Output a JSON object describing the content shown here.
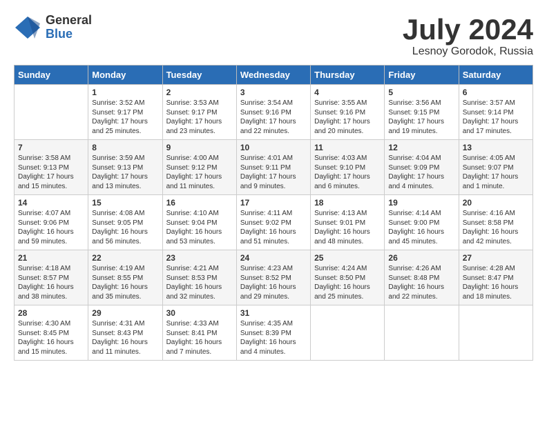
{
  "header": {
    "logo_general": "General",
    "logo_blue": "Blue",
    "month_title": "July 2024",
    "location": "Lesnoy Gorodok, Russia"
  },
  "days_of_week": [
    "Sunday",
    "Monday",
    "Tuesday",
    "Wednesday",
    "Thursday",
    "Friday",
    "Saturday"
  ],
  "weeks": [
    [
      {
        "day": "",
        "sunrise": "",
        "sunset": "",
        "daylight": ""
      },
      {
        "day": "1",
        "sunrise": "Sunrise: 3:52 AM",
        "sunset": "Sunset: 9:17 PM",
        "daylight": "Daylight: 17 hours and 25 minutes."
      },
      {
        "day": "2",
        "sunrise": "Sunrise: 3:53 AM",
        "sunset": "Sunset: 9:17 PM",
        "daylight": "Daylight: 17 hours and 23 minutes."
      },
      {
        "day": "3",
        "sunrise": "Sunrise: 3:54 AM",
        "sunset": "Sunset: 9:16 PM",
        "daylight": "Daylight: 17 hours and 22 minutes."
      },
      {
        "day": "4",
        "sunrise": "Sunrise: 3:55 AM",
        "sunset": "Sunset: 9:16 PM",
        "daylight": "Daylight: 17 hours and 20 minutes."
      },
      {
        "day": "5",
        "sunrise": "Sunrise: 3:56 AM",
        "sunset": "Sunset: 9:15 PM",
        "daylight": "Daylight: 17 hours and 19 minutes."
      },
      {
        "day": "6",
        "sunrise": "Sunrise: 3:57 AM",
        "sunset": "Sunset: 9:14 PM",
        "daylight": "Daylight: 17 hours and 17 minutes."
      }
    ],
    [
      {
        "day": "7",
        "sunrise": "Sunrise: 3:58 AM",
        "sunset": "Sunset: 9:13 PM",
        "daylight": "Daylight: 17 hours and 15 minutes."
      },
      {
        "day": "8",
        "sunrise": "Sunrise: 3:59 AM",
        "sunset": "Sunset: 9:13 PM",
        "daylight": "Daylight: 17 hours and 13 minutes."
      },
      {
        "day": "9",
        "sunrise": "Sunrise: 4:00 AM",
        "sunset": "Sunset: 9:12 PM",
        "daylight": "Daylight: 17 hours and 11 minutes."
      },
      {
        "day": "10",
        "sunrise": "Sunrise: 4:01 AM",
        "sunset": "Sunset: 9:11 PM",
        "daylight": "Daylight: 17 hours and 9 minutes."
      },
      {
        "day": "11",
        "sunrise": "Sunrise: 4:03 AM",
        "sunset": "Sunset: 9:10 PM",
        "daylight": "Daylight: 17 hours and 6 minutes."
      },
      {
        "day": "12",
        "sunrise": "Sunrise: 4:04 AM",
        "sunset": "Sunset: 9:09 PM",
        "daylight": "Daylight: 17 hours and 4 minutes."
      },
      {
        "day": "13",
        "sunrise": "Sunrise: 4:05 AM",
        "sunset": "Sunset: 9:07 PM",
        "daylight": "Daylight: 17 hours and 1 minute."
      }
    ],
    [
      {
        "day": "14",
        "sunrise": "Sunrise: 4:07 AM",
        "sunset": "Sunset: 9:06 PM",
        "daylight": "Daylight: 16 hours and 59 minutes."
      },
      {
        "day": "15",
        "sunrise": "Sunrise: 4:08 AM",
        "sunset": "Sunset: 9:05 PM",
        "daylight": "Daylight: 16 hours and 56 minutes."
      },
      {
        "day": "16",
        "sunrise": "Sunrise: 4:10 AM",
        "sunset": "Sunset: 9:04 PM",
        "daylight": "Daylight: 16 hours and 53 minutes."
      },
      {
        "day": "17",
        "sunrise": "Sunrise: 4:11 AM",
        "sunset": "Sunset: 9:02 PM",
        "daylight": "Daylight: 16 hours and 51 minutes."
      },
      {
        "day": "18",
        "sunrise": "Sunrise: 4:13 AM",
        "sunset": "Sunset: 9:01 PM",
        "daylight": "Daylight: 16 hours and 48 minutes."
      },
      {
        "day": "19",
        "sunrise": "Sunrise: 4:14 AM",
        "sunset": "Sunset: 9:00 PM",
        "daylight": "Daylight: 16 hours and 45 minutes."
      },
      {
        "day": "20",
        "sunrise": "Sunrise: 4:16 AM",
        "sunset": "Sunset: 8:58 PM",
        "daylight": "Daylight: 16 hours and 42 minutes."
      }
    ],
    [
      {
        "day": "21",
        "sunrise": "Sunrise: 4:18 AM",
        "sunset": "Sunset: 8:57 PM",
        "daylight": "Daylight: 16 hours and 38 minutes."
      },
      {
        "day": "22",
        "sunrise": "Sunrise: 4:19 AM",
        "sunset": "Sunset: 8:55 PM",
        "daylight": "Daylight: 16 hours and 35 minutes."
      },
      {
        "day": "23",
        "sunrise": "Sunrise: 4:21 AM",
        "sunset": "Sunset: 8:53 PM",
        "daylight": "Daylight: 16 hours and 32 minutes."
      },
      {
        "day": "24",
        "sunrise": "Sunrise: 4:23 AM",
        "sunset": "Sunset: 8:52 PM",
        "daylight": "Daylight: 16 hours and 29 minutes."
      },
      {
        "day": "25",
        "sunrise": "Sunrise: 4:24 AM",
        "sunset": "Sunset: 8:50 PM",
        "daylight": "Daylight: 16 hours and 25 minutes."
      },
      {
        "day": "26",
        "sunrise": "Sunrise: 4:26 AM",
        "sunset": "Sunset: 8:48 PM",
        "daylight": "Daylight: 16 hours and 22 minutes."
      },
      {
        "day": "27",
        "sunrise": "Sunrise: 4:28 AM",
        "sunset": "Sunset: 8:47 PM",
        "daylight": "Daylight: 16 hours and 18 minutes."
      }
    ],
    [
      {
        "day": "28",
        "sunrise": "Sunrise: 4:30 AM",
        "sunset": "Sunset: 8:45 PM",
        "daylight": "Daylight: 16 hours and 15 minutes."
      },
      {
        "day": "29",
        "sunrise": "Sunrise: 4:31 AM",
        "sunset": "Sunset: 8:43 PM",
        "daylight": "Daylight: 16 hours and 11 minutes."
      },
      {
        "day": "30",
        "sunrise": "Sunrise: 4:33 AM",
        "sunset": "Sunset: 8:41 PM",
        "daylight": "Daylight: 16 hours and 7 minutes."
      },
      {
        "day": "31",
        "sunrise": "Sunrise: 4:35 AM",
        "sunset": "Sunset: 8:39 PM",
        "daylight": "Daylight: 16 hours and 4 minutes."
      },
      {
        "day": "",
        "sunrise": "",
        "sunset": "",
        "daylight": ""
      },
      {
        "day": "",
        "sunrise": "",
        "sunset": "",
        "daylight": ""
      },
      {
        "day": "",
        "sunrise": "",
        "sunset": "",
        "daylight": ""
      }
    ]
  ]
}
